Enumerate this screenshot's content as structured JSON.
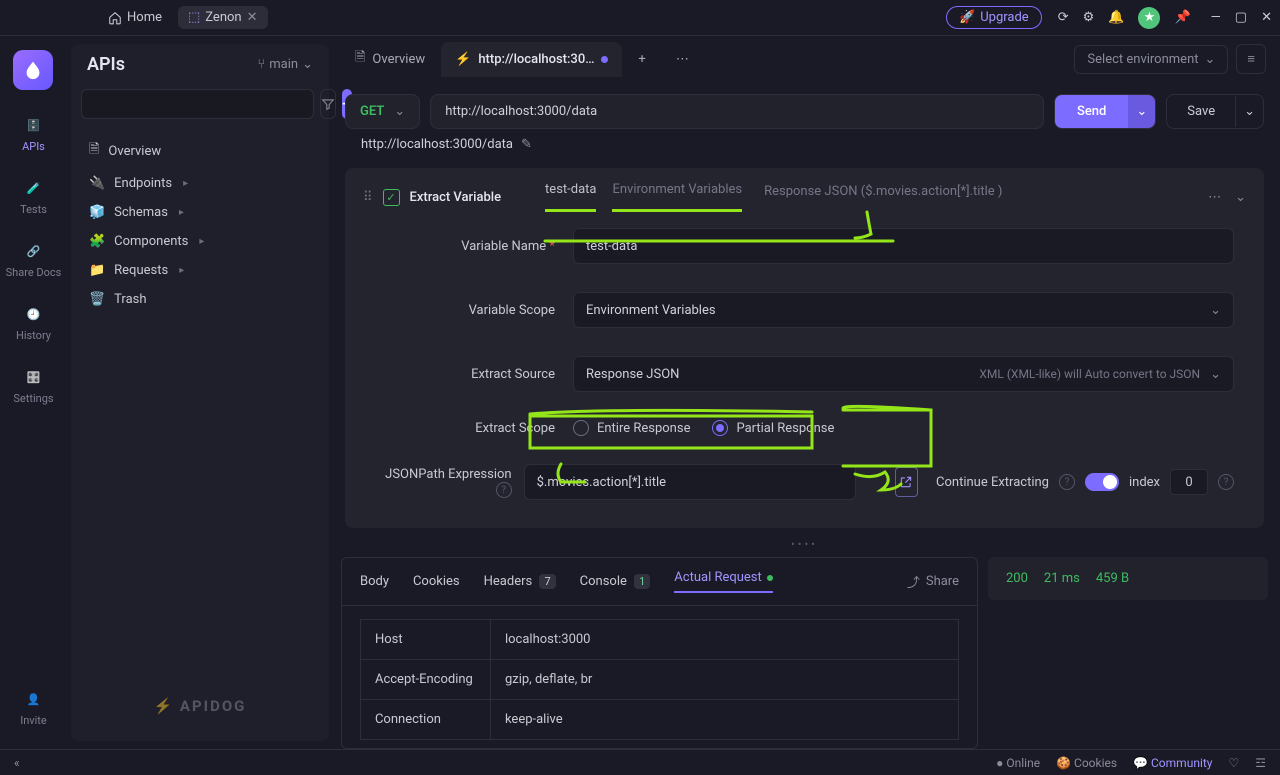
{
  "titlebar": {
    "home": "Home",
    "projectTab": "Zenon",
    "upgrade": "Upgrade"
  },
  "rail": {
    "apis": "APIs",
    "tests": "Tests",
    "sharedocs": "Share Docs",
    "history": "History",
    "settings": "Settings",
    "invite": "Invite"
  },
  "sidepanel": {
    "title": "APIs",
    "branch": "main",
    "items": {
      "overview": "Overview",
      "endpoints": "Endpoints",
      "schemas": "Schemas",
      "components": "Components",
      "requests": "Requests",
      "trash": "Trash"
    },
    "brand": "⚡ APIDOG"
  },
  "editorTabs": {
    "overview": "Overview",
    "request": "http://localhost:30…",
    "envSelect": "Select environment"
  },
  "requestBar": {
    "method": "GET",
    "url": "http://localhost:3000/data",
    "send": "Send",
    "save": "Save"
  },
  "requestName": "http://localhost:3000/data",
  "extract": {
    "header": {
      "title": "Extract Variable",
      "sub1": "test-data",
      "sub2": "Environment Variables",
      "sub3": "Response JSON ($.movies.action[*].title )"
    },
    "fields": {
      "variableName": {
        "label": "Variable Name",
        "value": "test-data"
      },
      "variableScope": {
        "label": "Variable Scope",
        "value": "Environment Variables"
      },
      "extractSource": {
        "label": "Extract Source",
        "value": "Response JSON",
        "hint": "XML (XML-like) will Auto convert to JSON"
      },
      "extractScope": {
        "label": "Extract Scope",
        "entire": "Entire Response",
        "partial": "Partial Response"
      },
      "jsonpath": {
        "label": "JSONPath Expression",
        "value": "$.movies.action[*].title"
      },
      "continue": {
        "label": "Continue Extracting",
        "indexLabel": "index",
        "indexValue": "0"
      }
    }
  },
  "response": {
    "tabs": {
      "body": "Body",
      "cookies": "Cookies",
      "headers": "Headers",
      "headersCount": "7",
      "console": "Console",
      "consoleCount": "1",
      "actual": "Actual Request",
      "share": "Share"
    },
    "status": {
      "code": "200",
      "time": "21 ms",
      "size": "459 B"
    },
    "headersTable": [
      {
        "k": "Host",
        "v": "localhost:3000"
      },
      {
        "k": "Accept-Encoding",
        "v": "gzip, deflate, br"
      },
      {
        "k": "Connection",
        "v": "keep-alive"
      }
    ]
  },
  "footer": {
    "online": "Online",
    "cookies": "Cookies",
    "community": "Community"
  }
}
